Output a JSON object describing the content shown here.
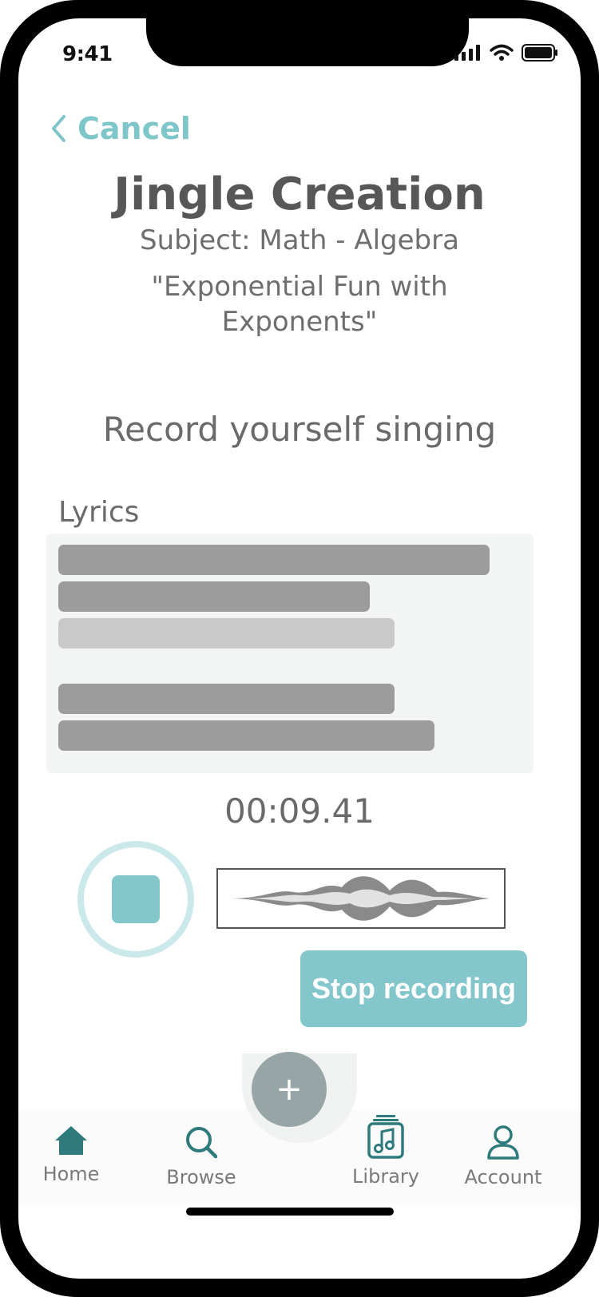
{
  "status_bar": {
    "time": "9:41"
  },
  "nav": {
    "cancel_label": "Cancel"
  },
  "header": {
    "title": "Jingle Creation",
    "subject": "Subject: Math - Algebra",
    "song_title": "\"Exponential Fun with Exponents\""
  },
  "recording": {
    "prompt": "Record yourself singing",
    "lyrics_label": "Lyrics",
    "timer": "00:09.41",
    "stop_label": "Stop recording"
  },
  "tabbar": {
    "home": "Home",
    "browse": "Browse",
    "library": "Library",
    "account": "Account",
    "add_symbol": "+"
  },
  "colors": {
    "accent": "#83c7cc",
    "accent_light": "#cbe8ea",
    "tab_icon": "#2e7a7c",
    "fab": "#96a6a6"
  }
}
